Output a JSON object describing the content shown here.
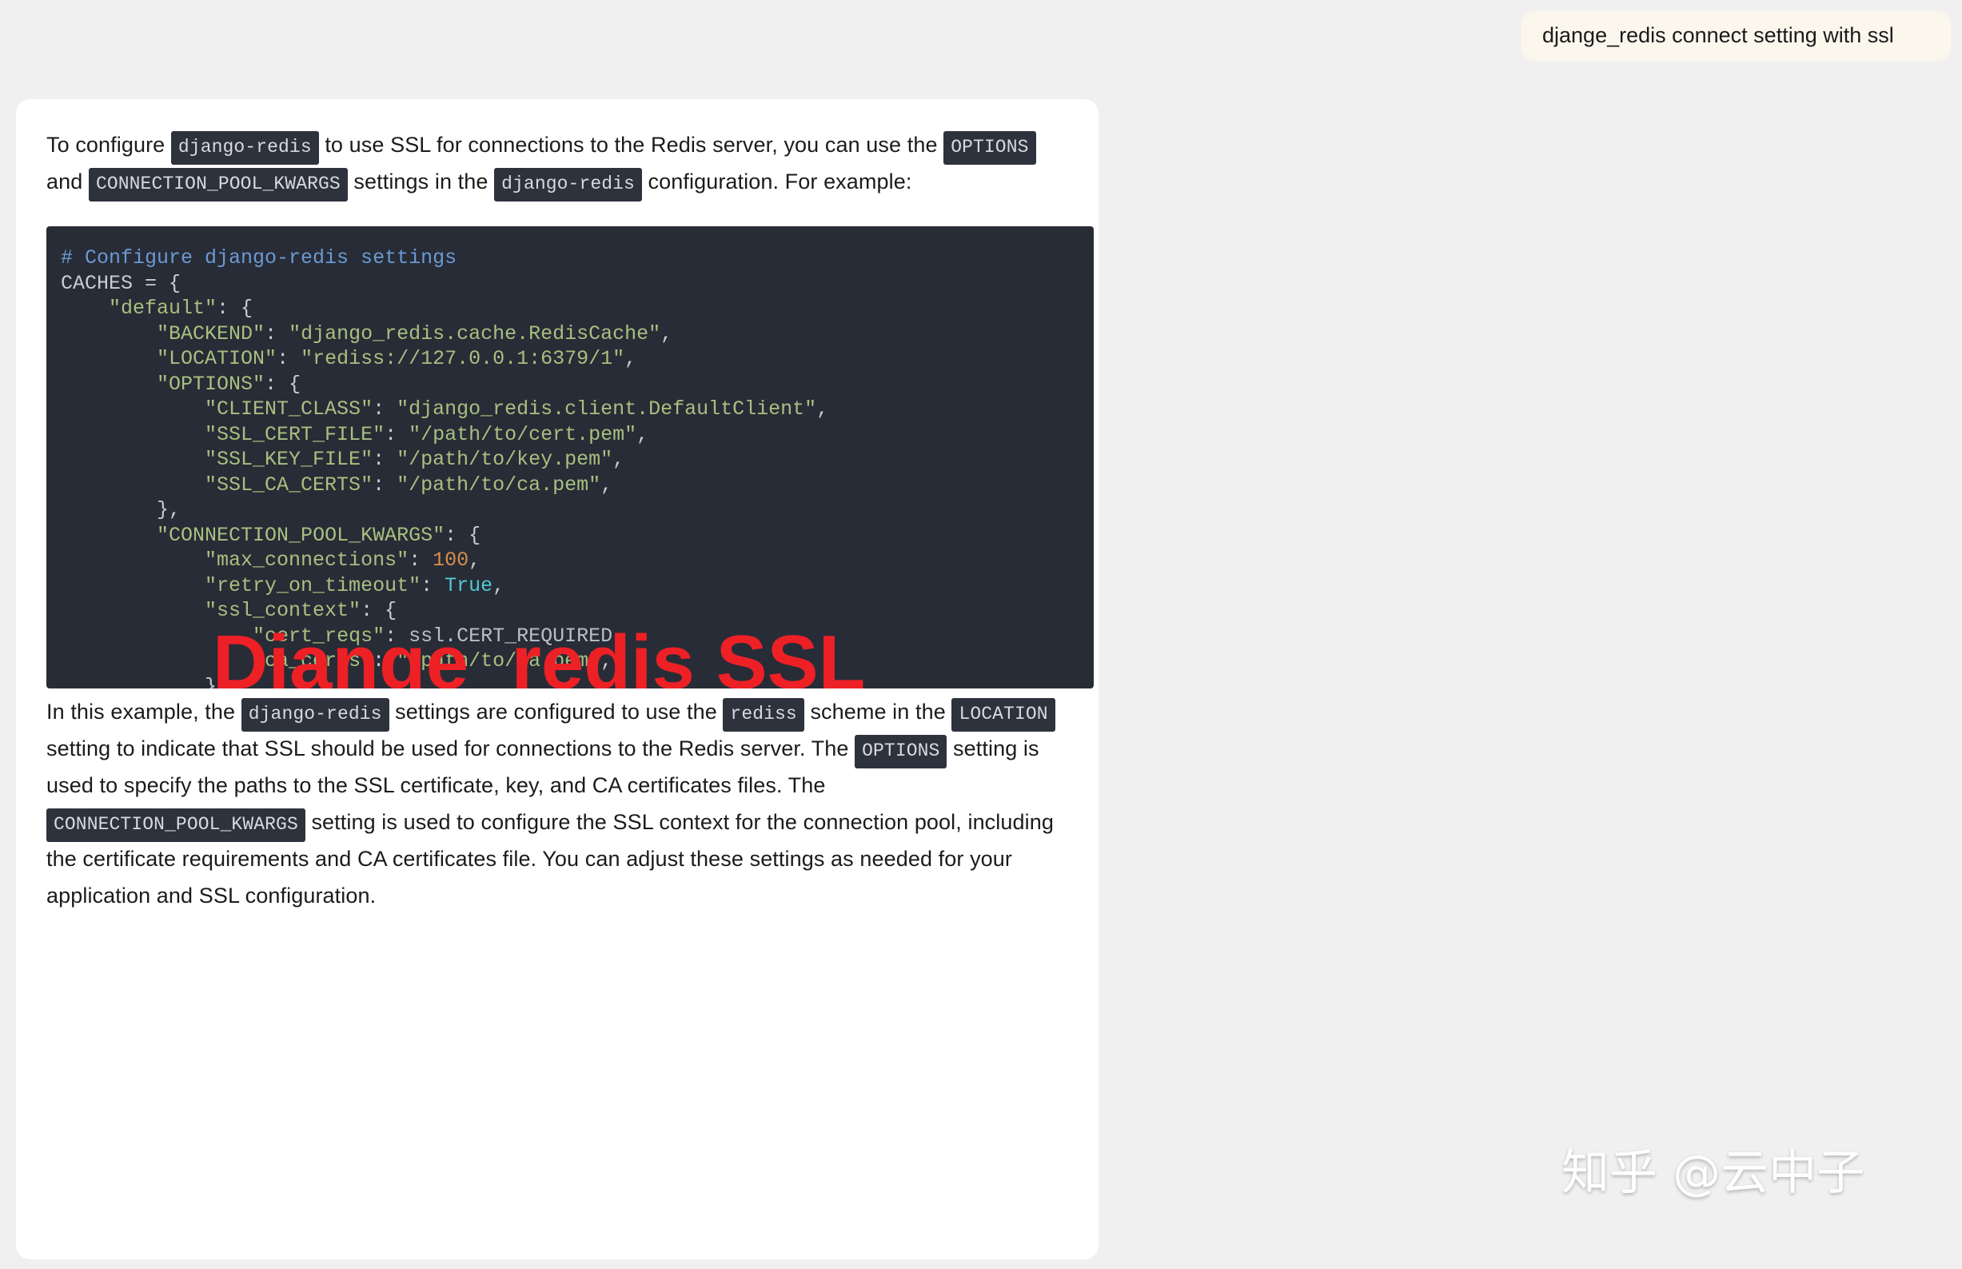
{
  "page": {
    "background_color": "#f0f0f0",
    "card_background": "#ffffff"
  },
  "user_message": {
    "text": "djange_redis connect setting with ssl",
    "bubble_color": "#fbf7ec"
  },
  "answer": {
    "intro": {
      "s1": "To configure ",
      "c1": "django-redis",
      "s2": " to use SSL for connections to the Redis server, you can use the ",
      "c2": "OPTIONS",
      "s3": " and ",
      "c3": "CONNECTION_POOL_KWARGS",
      "s4": " settings in the ",
      "c4": "django-redis",
      "s5": " configuration. For example:"
    },
    "outro": {
      "s1": "In this example, the ",
      "c1": "django-redis",
      "s2": " settings are configured to use the ",
      "c2": "rediss",
      "s3": " scheme in the ",
      "c3": "LOCATION",
      "s4": " setting to indicate that SSL should be used for connections to the Redis server. The ",
      "c4": "OPTIONS",
      "s5": " setting is used to specify the paths to the SSL certificate, key, and CA certificates files. The ",
      "c5": "CONNECTION_POOL_KWARGS",
      "s6": " setting is used to configure the SSL context for the connection pool, including the certificate requirements and CA certificates file. You can adjust these settings as needed for your application and SSL configuration."
    }
  },
  "code_block": {
    "language": "python",
    "background_color": "#282c36",
    "overlay_text": "Djange_redis SSL",
    "overlay_color": "#ed2026",
    "lines": [
      "# Configure django-redis settings",
      "CACHES = {",
      "    \"default\": {",
      "        \"BACKEND\": \"django_redis.cache.RedisCache\",",
      "        \"LOCATION\": \"rediss://127.0.0.1:6379/1\",",
      "        \"OPTIONS\": {",
      "            \"CLIENT_CLASS\": \"django_redis.client.DefaultClient\",",
      "            \"SSL_CERT_FILE\": \"/path/to/cert.pem\",",
      "            \"SSL_KEY_FILE\": \"/path/to/key.pem\",",
      "            \"SSL_CA_CERTS\": \"/path/to/ca.pem\",",
      "        },",
      "        \"CONNECTION_POOL_KWARGS\": {",
      "            \"max_connections\": 100,",
      "            \"retry_on_timeout\": True,",
      "            \"ssl_context\": {",
      "                \"cert_reqs\": ssl.CERT_REQUIRED,",
      "                \"ca_certs\": \"/path/to/ca.pem\",",
      "            }",
      "        }",
      "    }",
      "}"
    ]
  },
  "watermark": {
    "text": "知乎 @云中子"
  }
}
